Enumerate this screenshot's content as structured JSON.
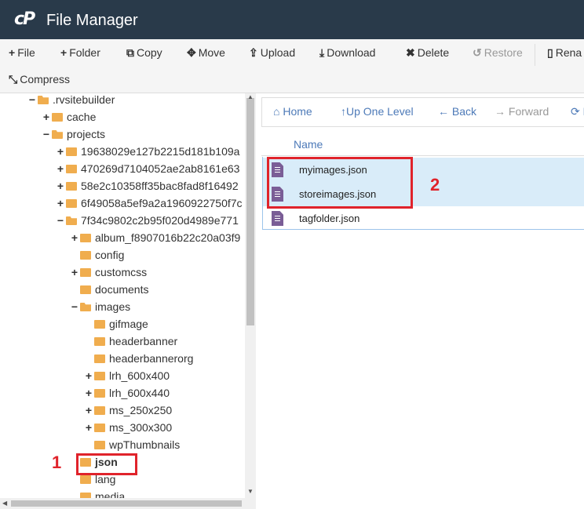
{
  "header": {
    "logo": "cP",
    "title": "File Manager"
  },
  "toolbar": {
    "row1": [
      {
        "icon": "+",
        "label": "File"
      },
      {
        "icon": "+",
        "label": "Folder"
      },
      {
        "icon": "⧉",
        "label": "Copy"
      },
      {
        "icon": "✥",
        "label": "Move"
      },
      {
        "icon": "⇪",
        "label": "Upload"
      },
      {
        "icon": "⤓",
        "label": "Download"
      },
      {
        "icon": "✖",
        "label": "Delete"
      },
      {
        "icon": "↺",
        "label": "Restore"
      },
      {
        "icon": "▯",
        "label": "Rena"
      }
    ],
    "compress": {
      "icon": "⤡",
      "label": "Compress"
    }
  },
  "tree": [
    {
      "toggle": "−",
      "label": ".rvsitebuilder",
      "open": true
    },
    {
      "toggle": "+",
      "label": "cache"
    },
    {
      "toggle": "−",
      "label": "projects",
      "open": true
    },
    {
      "toggle": "+",
      "label": "19638029e127b2215d181b109a"
    },
    {
      "toggle": "+",
      "label": "470269d7104052ae2ab8161e63"
    },
    {
      "toggle": "+",
      "label": "58e2c10358ff35bac8fad8f16492"
    },
    {
      "toggle": "+",
      "label": "6f49058a5ef9a2a1960922750f7c"
    },
    {
      "toggle": "−",
      "label": "7f34c9802c2b95f020d4989e771",
      "open": true
    },
    {
      "toggle": "+",
      "label": "album_f8907016b22c20a03f9"
    },
    {
      "toggle": "",
      "label": "config"
    },
    {
      "toggle": "+",
      "label": "customcss"
    },
    {
      "toggle": "",
      "label": "documents"
    },
    {
      "toggle": "−",
      "label": "images",
      "open": true
    },
    {
      "toggle": "",
      "label": "gifmage"
    },
    {
      "toggle": "",
      "label": "headerbanner"
    },
    {
      "toggle": "",
      "label": "headerbannerorg"
    },
    {
      "toggle": "+",
      "label": "lrh_600x400"
    },
    {
      "toggle": "+",
      "label": "lrh_600x440"
    },
    {
      "toggle": "+",
      "label": "ms_250x250"
    },
    {
      "toggle": "+",
      "label": "ms_300x300"
    },
    {
      "toggle": "",
      "label": "wpThumbnails"
    },
    {
      "toggle": "",
      "label": "json"
    },
    {
      "toggle": "",
      "label": "lang"
    },
    {
      "toggle": "",
      "label": "media"
    }
  ],
  "nav": [
    {
      "icon": "⌂",
      "label": "Home"
    },
    {
      "icon": "↑",
      "label": "Up One Level"
    },
    {
      "icon": "←",
      "label": "Back"
    },
    {
      "icon": "→",
      "label": "Forward"
    },
    {
      "icon": "⟳",
      "label": "R"
    }
  ],
  "list": {
    "column_name": "Name",
    "files": [
      "myimages.json",
      "storeimages.json",
      "tagfolder.json"
    ]
  },
  "annotations": {
    "one": "1",
    "two": "2"
  },
  "colors": {
    "header": "#293a4a",
    "accent": "#4d7ab8",
    "highlight": "#e0232b",
    "folder": "#f0ad4e",
    "selection": "#d9ecf9"
  }
}
